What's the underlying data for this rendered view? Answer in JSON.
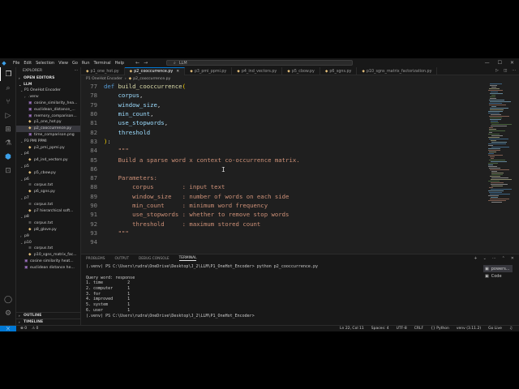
{
  "window": {
    "menu": [
      "File",
      "Edit",
      "Selection",
      "View",
      "Go",
      "Run",
      "Terminal",
      "Help"
    ],
    "search_text": "LLM",
    "icons": {
      "logo": "vscode-icon",
      "back": "arrow-left-icon",
      "forward": "arrow-right-icon",
      "minimize": "minimize-icon",
      "maximize": "maximize-icon",
      "close": "close-icon"
    }
  },
  "activity_bar": [
    "explorer-icon",
    "search-icon",
    "source-control-icon",
    "run-debug-icon",
    "extensions-icon",
    "testing-icon",
    "python-icon",
    "remote-icon",
    "account-icon",
    "settings-icon"
  ],
  "sidebar": {
    "header": "EXPLORER",
    "open_editors": "OPEN EDITORS",
    "root": "LLM",
    "tree": [
      {
        "label": "P1 OneHot Encoder",
        "depth": 1,
        "type": "folder",
        "open": true
      },
      {
        "label": ".venv",
        "depth": 2,
        "type": "folder",
        "open": false
      },
      {
        "label": "cosine_similarity_hea...",
        "depth": 2,
        "type": "png"
      },
      {
        "label": "euclidean_distance_...",
        "depth": 2,
        "type": "png"
      },
      {
        "label": "memory_comparison...",
        "depth": 2,
        "type": "png"
      },
      {
        "label": "p1_one_hot.py",
        "depth": 2,
        "type": "py"
      },
      {
        "label": "p2_cooccurrence.py",
        "depth": 2,
        "type": "py",
        "selected": true
      },
      {
        "label": "time_comparison.png",
        "depth": 2,
        "type": "png"
      },
      {
        "label": "P3 PMI PPMI",
        "depth": 1,
        "type": "folder",
        "open": true
      },
      {
        "label": "p3_pmi_ppmi.py",
        "depth": 2,
        "type": "py"
      },
      {
        "label": "p4",
        "depth": 1,
        "type": "folder",
        "open": true
      },
      {
        "label": "p4_ind_vectors.py",
        "depth": 2,
        "type": "py"
      },
      {
        "label": "p5",
        "depth": 1,
        "type": "folder",
        "open": true
      },
      {
        "label": "p5_cbow.py",
        "depth": 2,
        "type": "py"
      },
      {
        "label": "p6",
        "depth": 1,
        "type": "folder",
        "open": true
      },
      {
        "label": "corpus.txt",
        "depth": 2,
        "type": "txt"
      },
      {
        "label": "p6_sgns.py",
        "depth": 2,
        "type": "py"
      },
      {
        "label": "p7",
        "depth": 1,
        "type": "folder",
        "open": true
      },
      {
        "label": "corpus.txt",
        "depth": 2,
        "type": "txt"
      },
      {
        "label": "p7 hierarchical soft...",
        "depth": 2,
        "type": "py"
      },
      {
        "label": "p8",
        "depth": 1,
        "type": "folder",
        "open": true
      },
      {
        "label": "corpus.txt",
        "depth": 2,
        "type": "txt"
      },
      {
        "label": "p8_glove.py",
        "depth": 2,
        "type": "py"
      },
      {
        "label": "p9",
        "depth": 1,
        "type": "folder",
        "open": false
      },
      {
        "label": "p10",
        "depth": 1,
        "type": "folder",
        "open": true
      },
      {
        "label": "corpus.txt",
        "depth": 2,
        "type": "txt"
      },
      {
        "label": "p10_sgns_matrix_fac...",
        "depth": 2,
        "type": "py"
      },
      {
        "label": "cosine similarity heat...",
        "depth": 1,
        "type": "png"
      },
      {
        "label": "euclidean distance he...",
        "depth": 1,
        "type": "png"
      }
    ],
    "outline": "OUTLINE",
    "timeline": "TIMELINE"
  },
  "tabs": [
    {
      "label": "p1_one_hot.py",
      "active": false
    },
    {
      "label": "p2_cooccurrence.py",
      "active": true
    },
    {
      "label": "p3_pmi_ppmi.py",
      "active": false
    },
    {
      "label": "p4_ind_vectors.py",
      "active": false
    },
    {
      "label": "p5_cbow.py",
      "active": false
    },
    {
      "label": "p6_sgns.py",
      "active": false
    },
    {
      "label": "p10_sgns_matrix_factorization.py",
      "active": false
    }
  ],
  "breadcrumb": [
    "P1 OneHot Encoder",
    "p2_cooccurrence.py"
  ],
  "editor": {
    "lines": [
      {
        "n": "77",
        "t": [
          [
            "kw",
            "def "
          ],
          [
            "fn",
            "build_cooccurrence"
          ],
          [
            "gold",
            "("
          ]
        ]
      },
      {
        "n": "78",
        "t": [
          [
            "pn",
            "    "
          ],
          [
            "pm",
            "corpus"
          ],
          [
            "pn",
            ","
          ]
        ]
      },
      {
        "n": "79",
        "t": [
          [
            "pn",
            "    "
          ],
          [
            "pm",
            "window_size"
          ],
          [
            "pn",
            ","
          ]
        ]
      },
      {
        "n": "80",
        "t": [
          [
            "pn",
            "    "
          ],
          [
            "pm",
            "min_count"
          ],
          [
            "pn",
            ","
          ]
        ]
      },
      {
        "n": "81",
        "t": [
          [
            "pn",
            "    "
          ],
          [
            "pm",
            "use_stopwords"
          ],
          [
            "pn",
            ","
          ]
        ]
      },
      {
        "n": "82",
        "t": [
          [
            "pn",
            "    "
          ],
          [
            "pm",
            "threshold"
          ]
        ]
      },
      {
        "n": "83",
        "t": [
          [
            "gold",
            ")"
          ],
          [
            "pn",
            ":"
          ]
        ]
      },
      {
        "n": "84",
        "t": [
          [
            "pn",
            "    "
          ],
          [
            "st",
            "\"\"\""
          ]
        ]
      },
      {
        "n": "85",
        "t": [
          [
            "st",
            "    Build a sparse word x context co-occurrence matrix."
          ]
        ]
      },
      {
        "n": "86",
        "t": [
          [
            "st",
            ""
          ]
        ]
      },
      {
        "n": "87",
        "t": [
          [
            "st",
            "    Parameters:"
          ]
        ]
      },
      {
        "n": "88",
        "t": [
          [
            "st",
            "        corpus        : input text"
          ]
        ]
      },
      {
        "n": "89",
        "t": [
          [
            "st",
            "        window_size   : number of words on each side"
          ]
        ]
      },
      {
        "n": "90",
        "t": [
          [
            "st",
            "        min_count     : minimum word frequency"
          ]
        ]
      },
      {
        "n": "91",
        "t": [
          [
            "st",
            "        use_stopwords : whether to remove stop words"
          ]
        ]
      },
      {
        "n": "92",
        "t": [
          [
            "st",
            "        threshold     : maximum stored count"
          ]
        ]
      },
      {
        "n": "93",
        "t": [
          [
            "st",
            "    \"\"\""
          ]
        ]
      },
      {
        "n": "94",
        "t": [
          [
            "st",
            ""
          ]
        ]
      }
    ]
  },
  "panel": {
    "tabs": [
      "PROBLEMS",
      "OUTPUT",
      "DEBUG CONSOLE",
      "TERMINAL"
    ],
    "active_tab": "TERMINAL",
    "terminal_lines": [
      "(.venv) PS C:\\Users\\rudra\\OneDrive\\Desktop\\J_2\\LLM\\P1_OneHot_Encoder> python p2_cooccurrence.py",
      "",
      "Query word: response",
      "1. time          2",
      "2. computer      1",
      "3. for           1",
      "4. improved      1",
      "5. system        1",
      "6. user          1",
      "(.venv) PS C:\\Users\\rudra\\OneDrive\\Desktop\\J_2\\LLM\\P1_OneHot_Encoder> "
    ],
    "terminals": [
      {
        "label": "powers...",
        "selected": true
      },
      {
        "label": "Code",
        "selected": false
      }
    ]
  },
  "status": {
    "left": [
      "0",
      "0"
    ],
    "right": [
      "Ln 22, Col 11",
      "Spaces: 4",
      "UTF-8",
      "CRLF",
      "{} Python",
      "venv (3.11.2)",
      "Go Live"
    ]
  },
  "colors": {
    "accent": "#0078d4",
    "editor_bg": "#1f1f1f",
    "sidebar_bg": "#181818",
    "keyword": "#569cd6",
    "function": "#dcdcaa",
    "param": "#9cdcfe",
    "string": "#ce9178"
  }
}
